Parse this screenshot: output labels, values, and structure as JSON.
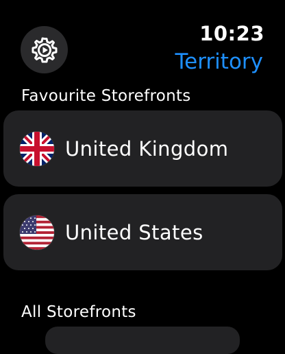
{
  "status": {
    "time": "10:23"
  },
  "header": {
    "title": "Territory",
    "settings_icon": "gear-icon",
    "accent_color": "#1e90ff"
  },
  "sections": {
    "favourites": {
      "label": "Favourite Storefronts",
      "items": [
        {
          "label": "United Kingdom",
          "icon": "uk-flag-icon"
        },
        {
          "label": "United States",
          "icon": "us-flag-icon"
        }
      ]
    },
    "all": {
      "label": "All Storefronts"
    }
  }
}
